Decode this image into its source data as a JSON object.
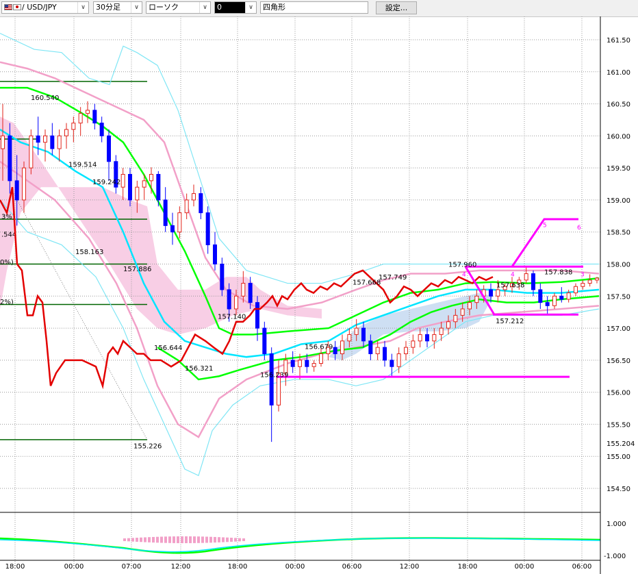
{
  "toolbar": {
    "symbol": "/ USD/JPY",
    "timeframe": "30分足",
    "chart_style": "ローソク",
    "draw_tool_value": "0",
    "draw_shape": "四角形",
    "settings_label": "設定..."
  },
  "colors": {
    "bull": "#e2231a",
    "bear": "#0000ff",
    "grid": "#9a9a9a",
    "cloud": "#f7c6e0",
    "cloud_bear": "#c9dcf2",
    "ma_short": "#00e5ff",
    "ma_long": "#00ff00",
    "bb1": "#f2a0c8",
    "bb2": "#7fe6f5",
    "rsi": "#e30000",
    "fib": "#006400",
    "zigzag": "#ff00ff"
  },
  "chart_data": {
    "type": "candlestick",
    "symbol": "USD/JPY",
    "timeframe": "30分足",
    "y_ticks": [
      "161.50",
      "161.00",
      "160.50",
      "160.00",
      "159.50",
      "159.00",
      "158.50",
      "158.00",
      "157.50",
      "157.00",
      "156.50",
      "156.00",
      "155.50",
      "155.00",
      "154.50"
    ],
    "ylim": [
      154.13,
      161.8
    ],
    "current_price_label": "155.204",
    "x_ticks": [
      "18:00",
      "00:00",
      "07:00",
      "12:00",
      "18:00",
      "00:00",
      "06:00",
      "12:00",
      "18:00",
      "00:00",
      "06:00"
    ],
    "oscillator_ticks": [
      "1.000",
      "-1.000"
    ],
    "price_annotations": [
      {
        "label": "160.540",
        "value": 160.54
      },
      {
        "label": "159.514",
        "value": 159.514
      },
      {
        "label": "159.242",
        "value": 159.242
      },
      {
        "label": "158.163",
        "value": 158.163
      },
      {
        "label": "157.886",
        "value": 157.886
      },
      {
        "label": "156.644",
        "value": 156.644
      },
      {
        "label": "156.321",
        "value": 156.321
      },
      {
        "label": "155.226",
        "value": 155.226
      },
      {
        "label": "157.140",
        "value": 157.14
      },
      {
        "label": "156.239",
        "value": 156.239
      },
      {
        "label": "156.679",
        "value": 156.679
      },
      {
        "label": "157.668",
        "value": 157.668
      },
      {
        "label": "157.749",
        "value": 157.749
      },
      {
        "label": "157.960",
        "value": 157.96
      },
      {
        "label": "157.638",
        "value": 157.638
      },
      {
        "label": "157.212",
        "value": 157.212
      },
      {
        "label": "157.838",
        "value": 157.838
      }
    ],
    "fib_labels": [
      "3%)",
      ".544",
      "0%)",
      "2%)"
    ],
    "zigzag_labels": [
      "4",
      "4",
      "5",
      "6",
      "3"
    ],
    "candles": [
      {
        "o": 159.8,
        "h": 160.5,
        "l": 159.3,
        "c": 160.0
      },
      {
        "o": 160.0,
        "h": 160.2,
        "l": 159.1,
        "c": 159.3
      },
      {
        "o": 159.3,
        "h": 159.7,
        "l": 158.6,
        "c": 159.0
      },
      {
        "o": 159.0,
        "h": 159.6,
        "l": 158.8,
        "c": 159.5
      },
      {
        "o": 159.5,
        "h": 160.1,
        "l": 159.4,
        "c": 160.0
      },
      {
        "o": 160.0,
        "h": 160.3,
        "l": 159.7,
        "c": 159.9
      },
      {
        "o": 159.9,
        "h": 160.1,
        "l": 159.6,
        "c": 160.0
      },
      {
        "o": 160.0,
        "h": 160.2,
        "l": 159.7,
        "c": 159.8
      },
      {
        "o": 159.8,
        "h": 160.1,
        "l": 159.6,
        "c": 160.0
      },
      {
        "o": 160.0,
        "h": 160.2,
        "l": 159.8,
        "c": 160.1
      },
      {
        "o": 160.1,
        "h": 160.3,
        "l": 159.9,
        "c": 160.2
      },
      {
        "o": 160.2,
        "h": 160.45,
        "l": 160.0,
        "c": 160.35
      },
      {
        "o": 160.35,
        "h": 160.54,
        "l": 160.2,
        "c": 160.4
      },
      {
        "o": 160.4,
        "h": 160.5,
        "l": 160.1,
        "c": 160.2
      },
      {
        "o": 160.2,
        "h": 160.3,
        "l": 159.9,
        "c": 160.0
      },
      {
        "o": 160.0,
        "h": 160.1,
        "l": 159.3,
        "c": 159.6
      },
      {
        "o": 159.6,
        "h": 159.7,
        "l": 159.1,
        "c": 159.2
      },
      {
        "o": 159.2,
        "h": 159.5,
        "l": 159.0,
        "c": 159.4
      },
      {
        "o": 159.4,
        "h": 159.5,
        "l": 158.9,
        "c": 159.0
      },
      {
        "o": 159.0,
        "h": 159.3,
        "l": 158.8,
        "c": 159.2
      },
      {
        "o": 159.2,
        "h": 159.4,
        "l": 159.0,
        "c": 159.3
      },
      {
        "o": 159.3,
        "h": 159.51,
        "l": 159.1,
        "c": 159.4
      },
      {
        "o": 159.4,
        "h": 159.45,
        "l": 158.9,
        "c": 159.0
      },
      {
        "o": 159.0,
        "h": 159.2,
        "l": 158.5,
        "c": 158.6
      },
      {
        "o": 158.6,
        "h": 158.8,
        "l": 158.3,
        "c": 158.5
      },
      {
        "o": 158.5,
        "h": 158.9,
        "l": 158.4,
        "c": 158.8
      },
      {
        "o": 158.8,
        "h": 159.1,
        "l": 158.7,
        "c": 159.0
      },
      {
        "o": 159.0,
        "h": 159.24,
        "l": 158.9,
        "c": 159.1
      },
      {
        "o": 159.1,
        "h": 159.2,
        "l": 158.7,
        "c": 158.8
      },
      {
        "o": 158.8,
        "h": 158.9,
        "l": 158.16,
        "c": 158.3
      },
      {
        "o": 158.3,
        "h": 158.5,
        "l": 157.9,
        "c": 158.0
      },
      {
        "o": 158.0,
        "h": 158.1,
        "l": 157.5,
        "c": 157.6
      },
      {
        "o": 157.6,
        "h": 157.7,
        "l": 157.1,
        "c": 157.3
      },
      {
        "o": 157.3,
        "h": 157.6,
        "l": 157.2,
        "c": 157.5
      },
      {
        "o": 157.5,
        "h": 157.89,
        "l": 157.4,
        "c": 157.7
      },
      {
        "o": 157.7,
        "h": 157.8,
        "l": 157.3,
        "c": 157.4
      },
      {
        "o": 157.4,
        "h": 157.5,
        "l": 156.8,
        "c": 157.0
      },
      {
        "o": 157.0,
        "h": 157.1,
        "l": 156.5,
        "c": 156.6
      },
      {
        "o": 156.6,
        "h": 156.7,
        "l": 155.226,
        "c": 155.8
      },
      {
        "o": 155.8,
        "h": 156.5,
        "l": 155.7,
        "c": 156.3
      },
      {
        "o": 156.3,
        "h": 156.6,
        "l": 156.1,
        "c": 156.5
      },
      {
        "o": 156.5,
        "h": 156.64,
        "l": 156.3,
        "c": 156.4
      },
      {
        "o": 156.4,
        "h": 156.6,
        "l": 156.2,
        "c": 156.5
      },
      {
        "o": 156.5,
        "h": 156.6,
        "l": 156.3,
        "c": 156.4
      },
      {
        "o": 156.4,
        "h": 156.5,
        "l": 156.32,
        "c": 156.45
      },
      {
        "o": 156.45,
        "h": 156.7,
        "l": 156.4,
        "c": 156.6
      },
      {
        "o": 156.6,
        "h": 156.8,
        "l": 156.5,
        "c": 156.7
      },
      {
        "o": 156.7,
        "h": 156.8,
        "l": 156.5,
        "c": 156.6
      },
      {
        "o": 156.6,
        "h": 156.9,
        "l": 156.5,
        "c": 156.8
      },
      {
        "o": 156.8,
        "h": 157.0,
        "l": 156.7,
        "c": 156.9
      },
      {
        "o": 156.9,
        "h": 157.14,
        "l": 156.8,
        "c": 157.0
      },
      {
        "o": 157.0,
        "h": 157.1,
        "l": 156.7,
        "c": 156.8
      },
      {
        "o": 156.8,
        "h": 156.9,
        "l": 156.5,
        "c": 156.6
      },
      {
        "o": 156.6,
        "h": 156.8,
        "l": 156.5,
        "c": 156.7
      },
      {
        "o": 156.7,
        "h": 156.8,
        "l": 156.4,
        "c": 156.5
      },
      {
        "o": 156.5,
        "h": 156.6,
        "l": 156.239,
        "c": 156.4
      },
      {
        "o": 156.4,
        "h": 156.7,
        "l": 156.3,
        "c": 156.6
      },
      {
        "o": 156.6,
        "h": 156.8,
        "l": 156.5,
        "c": 156.7
      },
      {
        "o": 156.7,
        "h": 156.9,
        "l": 156.6,
        "c": 156.8
      },
      {
        "o": 156.8,
        "h": 157.0,
        "l": 156.7,
        "c": 156.9
      },
      {
        "o": 156.9,
        "h": 157.0,
        "l": 156.7,
        "c": 156.8
      },
      {
        "o": 156.8,
        "h": 157.0,
        "l": 156.68,
        "c": 156.9
      },
      {
        "o": 156.9,
        "h": 157.1,
        "l": 156.8,
        "c": 157.0
      },
      {
        "o": 157.0,
        "h": 157.2,
        "l": 156.9,
        "c": 157.1
      },
      {
        "o": 157.1,
        "h": 157.3,
        "l": 157.0,
        "c": 157.2
      },
      {
        "o": 157.2,
        "h": 157.4,
        "l": 157.1,
        "c": 157.3
      },
      {
        "o": 157.3,
        "h": 157.5,
        "l": 157.2,
        "c": 157.4
      },
      {
        "o": 157.4,
        "h": 157.6,
        "l": 157.3,
        "c": 157.5
      },
      {
        "o": 157.5,
        "h": 157.67,
        "l": 157.4,
        "c": 157.6
      },
      {
        "o": 157.6,
        "h": 157.7,
        "l": 157.4,
        "c": 157.5
      },
      {
        "o": 157.5,
        "h": 157.75,
        "l": 157.4,
        "c": 157.6
      },
      {
        "o": 157.6,
        "h": 157.7,
        "l": 157.5,
        "c": 157.65
      },
      {
        "o": 157.65,
        "h": 157.8,
        "l": 157.55,
        "c": 157.7
      },
      {
        "o": 157.7,
        "h": 157.8,
        "l": 157.6,
        "c": 157.75
      },
      {
        "o": 157.75,
        "h": 157.96,
        "l": 157.7,
        "c": 157.85
      },
      {
        "o": 157.85,
        "h": 157.9,
        "l": 157.5,
        "c": 157.6
      },
      {
        "o": 157.6,
        "h": 157.7,
        "l": 157.3,
        "c": 157.4
      },
      {
        "o": 157.4,
        "h": 157.5,
        "l": 157.21,
        "c": 157.35
      },
      {
        "o": 157.35,
        "h": 157.55,
        "l": 157.3,
        "c": 157.5
      },
      {
        "o": 157.5,
        "h": 157.64,
        "l": 157.4,
        "c": 157.45
      },
      {
        "o": 157.45,
        "h": 157.6,
        "l": 157.4,
        "c": 157.55
      },
      {
        "o": 157.55,
        "h": 157.7,
        "l": 157.5,
        "c": 157.65
      },
      {
        "o": 157.65,
        "h": 157.75,
        "l": 157.6,
        "c": 157.7
      },
      {
        "o": 157.7,
        "h": 157.84,
        "l": 157.65,
        "c": 157.75
      },
      {
        "o": 157.75,
        "h": 157.8,
        "l": 157.7,
        "c": 157.78
      }
    ]
  }
}
